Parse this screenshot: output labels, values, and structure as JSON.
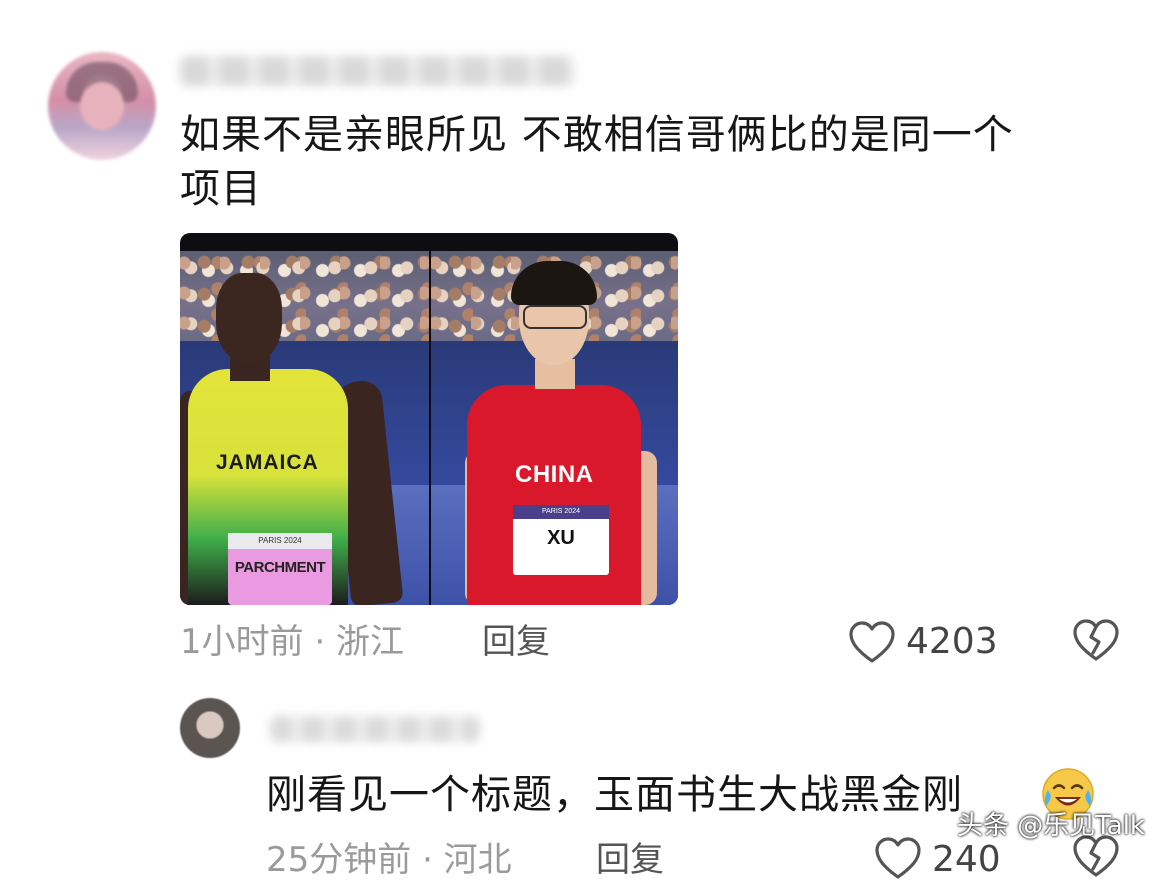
{
  "comments": [
    {
      "text_line1": "如果不是亲眼所见 不敢相信哥俩比的是同一个",
      "text_line2": "项目",
      "time_location": "1小时前 · 浙江",
      "reply_label": "回复",
      "like_count": "4203",
      "photo": {
        "left_jersey": "JAMAICA",
        "left_bib_event": "PARIS 2024",
        "left_bib_name": "PARCHMENT",
        "right_jersey": "CHINA",
        "right_bib_event": "PARIS 2024",
        "right_bib_name": "XU"
      }
    },
    {
      "text": "刚看见一个标题，玉面书生大战黑金刚",
      "emoji": "crying-laughing",
      "time_location": "25分钟前 · 河北",
      "reply_label": "回复",
      "like_count": "240"
    }
  ],
  "watermark": "头条 @乐见Talk",
  "colors": {
    "text_primary": "#161616",
    "text_meta": "#9a9a9a",
    "icon": "#555555"
  }
}
